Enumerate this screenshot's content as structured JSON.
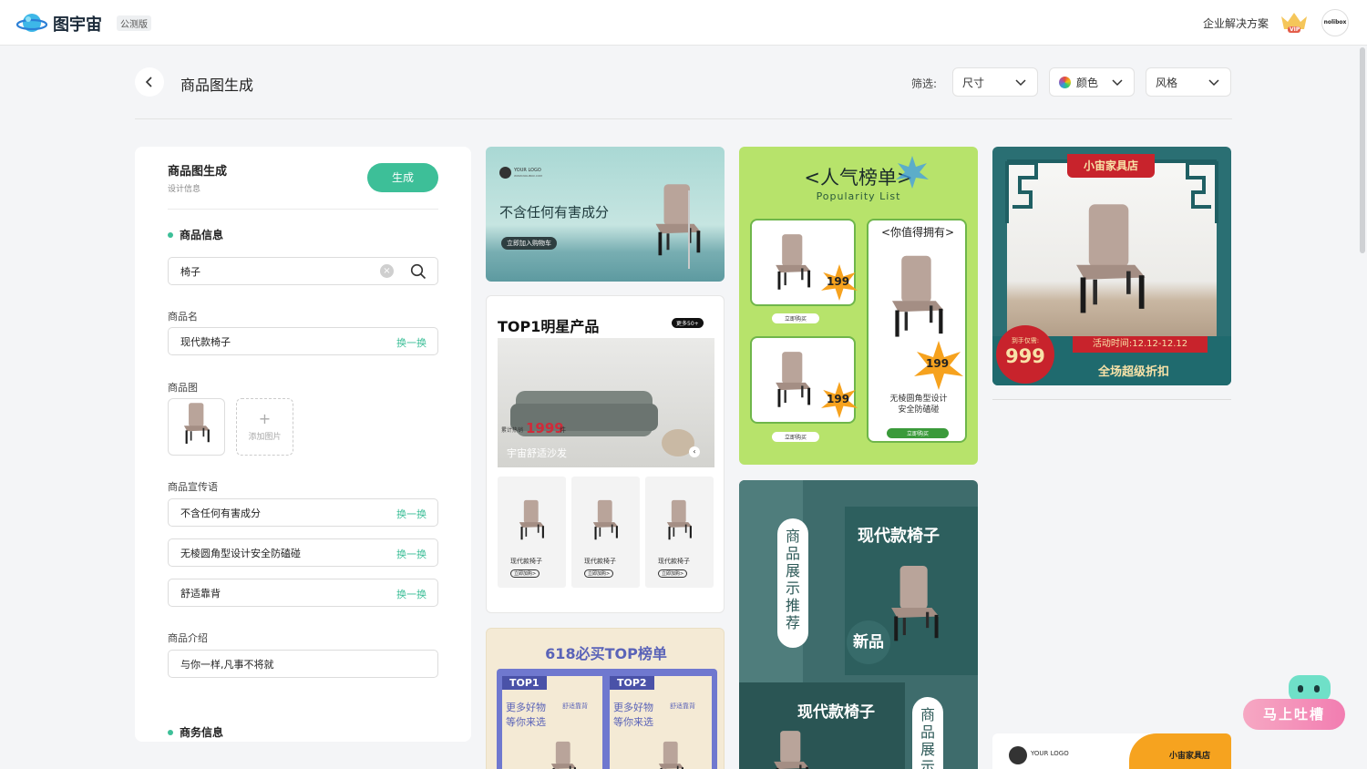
{
  "header": {
    "brand": "图宇宙",
    "badge": "公测版",
    "enterprise": "企业解决方案",
    "vip": "VIP",
    "avatar": "nolibox"
  },
  "page": {
    "title": "商品图生成"
  },
  "filters": {
    "label": "筛选:",
    "size": "尺寸",
    "color": "颜色",
    "style": "风格"
  },
  "panel": {
    "title": "商品图生成",
    "subtitle": "设计信息",
    "generate": "生成",
    "section_product": "商品信息",
    "search_value": "椅子",
    "name_label": "商品名",
    "name_value": "现代款椅子",
    "swap": "换一换",
    "image_label": "商品图",
    "add_image": "添加图片",
    "slogan_label": "商品宣传语",
    "slogans": [
      "不含任何有害成分",
      "无棱圆角型设计安全防磕碰",
      "舒适靠背"
    ],
    "intro_label": "商品介绍",
    "intro_value": "与你一样,凡事不将就",
    "section_business": "商务信息"
  },
  "cards": {
    "c1": {
      "logo": "YOUR LOGO",
      "logo_sub": "WWW.NOLIBOX.COM",
      "headline": "不含任何有害成分",
      "cta": "立即加入购物车"
    },
    "c2": {
      "title": "TOP1明星产品",
      "badge": "更多50+",
      "sold_label": "累计热销",
      "price": "1999",
      "unit": "件",
      "sofa": "宇宙舒适沙发",
      "item_name": "现代款椅子",
      "item_cta": "立即加购>"
    },
    "c3": {
      "title": "618必买TOP榜单",
      "top1": "TOP1",
      "top2": "TOP2",
      "line1": "更多好物",
      "line2": "等你来选",
      "tag": "舒适靠背"
    },
    "c4": {
      "title": "<人气榜单>",
      "subtitle": "Popularity List",
      "price": "199",
      "buy": "立即购买",
      "worth": "<你值得拥有>",
      "desc": "无棱圆角型设计安全防磕碰"
    },
    "c5": {
      "vertical1": "商品展示推荐",
      "title1": "现代款椅子",
      "new": "新品",
      "title2": "现代款椅子",
      "vertical2": "商品展示"
    },
    "c6": {
      "shop": "小宙家具店",
      "price_label": "到手仅需:",
      "price": "999",
      "time": "活动时间:12.12-12.12",
      "sale": "全场超级折扣"
    },
    "c7": {
      "logo": "YOUR LOGO",
      "shop": "小宙家具店"
    }
  },
  "feedback": {
    "label": "马上吐槽"
  },
  "colors": {
    "accent": "#3dbf98",
    "lime": "#b7e36b",
    "teal": "#2a6f73",
    "red": "#c8232c"
  }
}
